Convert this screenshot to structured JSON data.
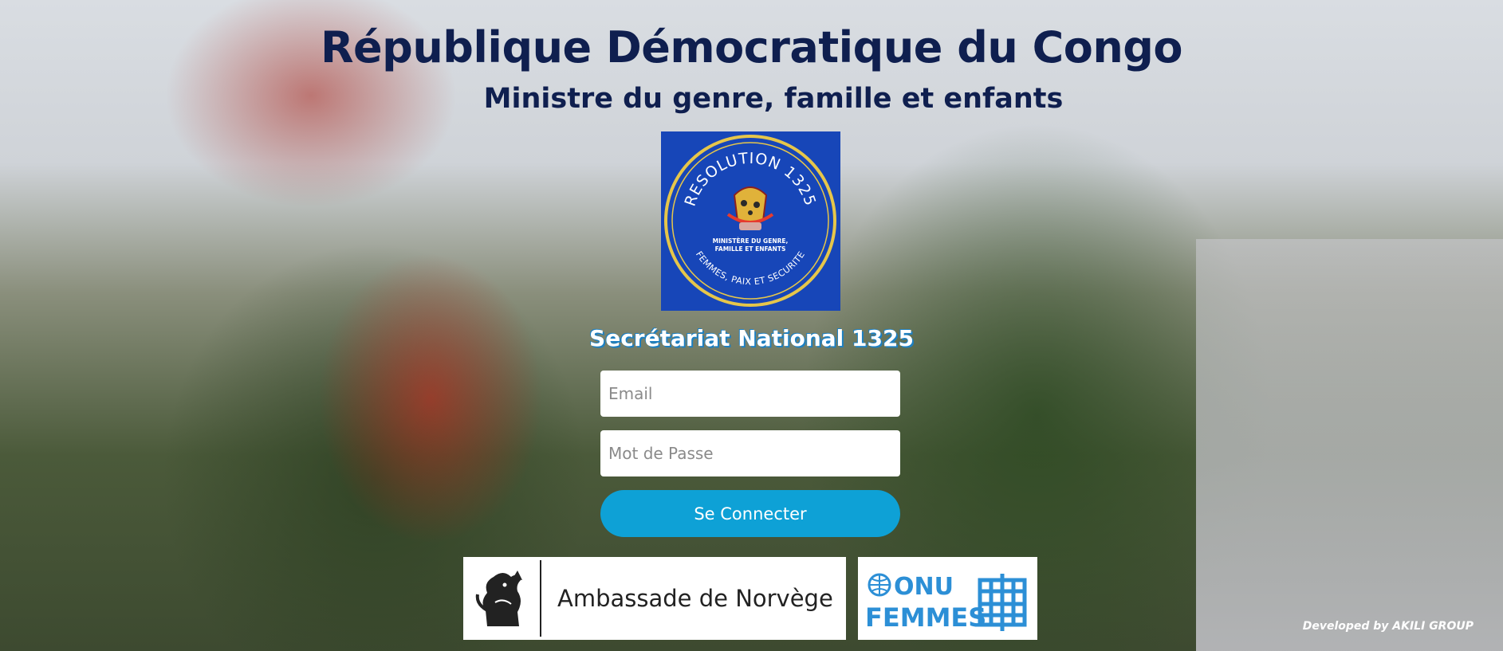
{
  "header": {
    "title": "République Démocratique du Congo",
    "subtitle": "Ministre du genre, famille et enfants"
  },
  "seal": {
    "top_text": "RESOLUTION 1325",
    "ministry_text_line1": "MINISTÈRE DU GENRE,",
    "ministry_text_line2": "FAMILLE ET ENFANTS",
    "bottom_text": "FEMMES, PAIX ET SECURITE"
  },
  "secretariat": "Secrétariat National 1325",
  "form": {
    "email_placeholder": "Email",
    "email_value": "",
    "password_placeholder": "Mot de Passe",
    "password_value": "",
    "submit_label": "Se Connecter"
  },
  "partners": {
    "norway_label": "Ambassade de Norvège",
    "onu_line1": "ONU",
    "onu_line2": "FEMMES"
  },
  "footer": "Developed by AKILI GROUP",
  "colors": {
    "title": "#0f1f4f",
    "button": "#0ea1d6",
    "seal_bg": "#1746b8",
    "seal_ring": "#e6c64a",
    "onu_blue": "#2c8fd6"
  }
}
